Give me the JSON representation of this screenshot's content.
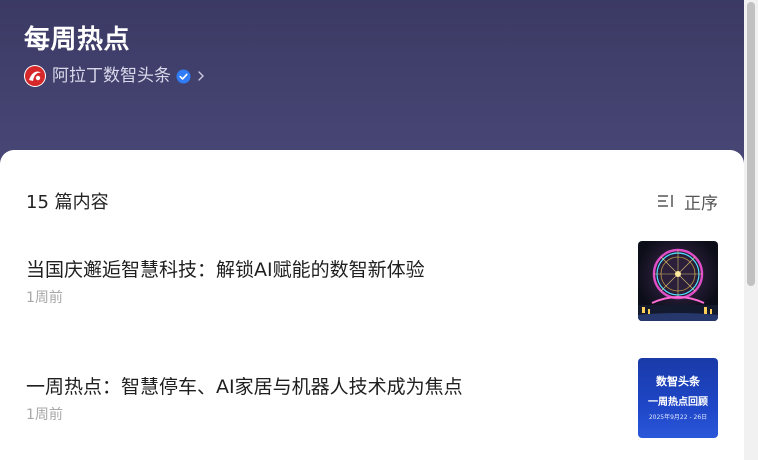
{
  "header": {
    "title": "每周热点",
    "author": "阿拉丁数智头条"
  },
  "list": {
    "count_label": "15 篇内容",
    "sort_label": "正序",
    "items": [
      {
        "title": "当国庆邂逅智慧科技：解锁AI赋能的数智新体验",
        "time": "1周前",
        "thumb": "ferris-wheel-night-photo"
      },
      {
        "title": "一周热点：智慧停车、AI家居与机器人技术成为焦点",
        "time": "1周前",
        "thumb": {
          "line1": "数智头条",
          "line2": "一周热点回顾",
          "line3": "2025年9月22 - 26日"
        }
      }
    ]
  },
  "colors": {
    "header_bg": "#3b3a64",
    "verified_badge": "#2f7cf6",
    "logo_red": "#d6282b"
  }
}
